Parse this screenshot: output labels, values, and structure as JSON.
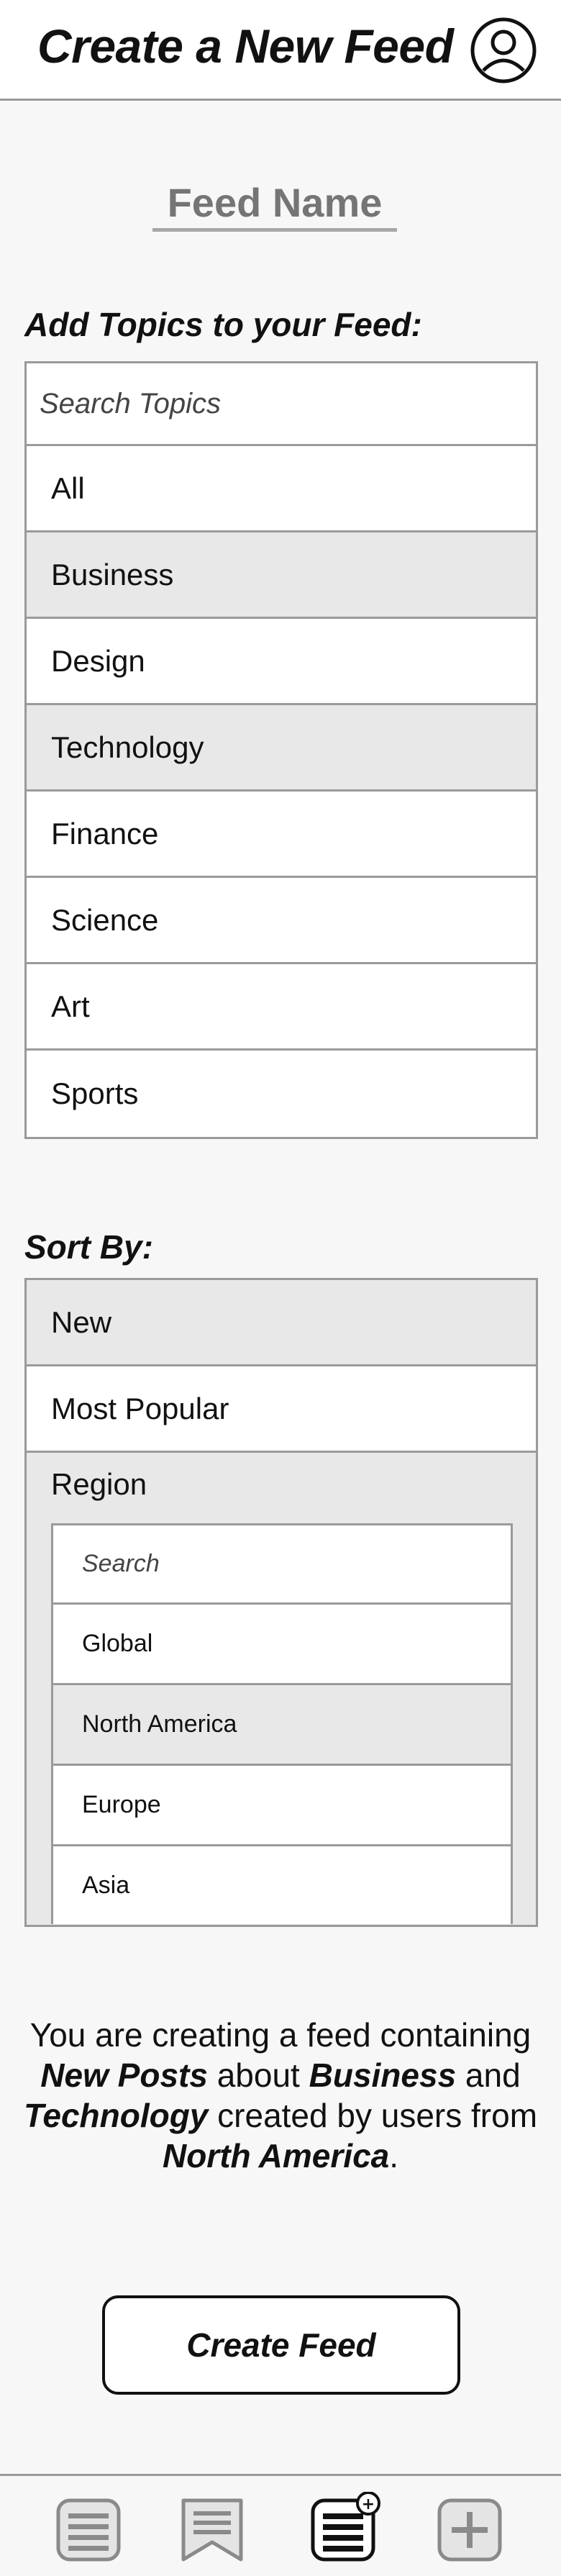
{
  "header": {
    "title": "Create a New Feed",
    "profile_icon": "user-circle-icon"
  },
  "feed_name": {
    "placeholder": "Feed Name",
    "value": ""
  },
  "topics": {
    "label": "Add Topics to your Feed:",
    "search_placeholder": "Search Topics",
    "items": [
      {
        "label": "All",
        "selected": false
      },
      {
        "label": "Business",
        "selected": true
      },
      {
        "label": "Design",
        "selected": false
      },
      {
        "label": "Technology",
        "selected": true
      },
      {
        "label": "Finance",
        "selected": false
      },
      {
        "label": "Science",
        "selected": false
      },
      {
        "label": "Art",
        "selected": false
      },
      {
        "label": "Sports",
        "selected": false
      }
    ]
  },
  "sort": {
    "label": "Sort By:",
    "items": [
      {
        "label": "New",
        "selected": true
      },
      {
        "label": "Most Popular",
        "selected": false
      }
    ],
    "region": {
      "label": "Region",
      "search_placeholder": "Search",
      "items": [
        {
          "label": "Global",
          "selected": false
        },
        {
          "label": "North America",
          "selected": true
        },
        {
          "label": "Europe",
          "selected": false
        },
        {
          "label": "Asia",
          "selected": false
        }
      ]
    }
  },
  "summary": {
    "p1": "You are creating a feed containing ",
    "b1": "New Posts",
    "p2": " about ",
    "b2": "Business",
    "p3": " and ",
    "b3": "Technology",
    "p4": " created by users from ",
    "b4": "North America",
    "p5": "."
  },
  "create_button": {
    "label": "Create Feed"
  },
  "bottom_nav": {
    "items": [
      {
        "icon": "feed-list-icon",
        "active": false
      },
      {
        "icon": "bookmark-icon",
        "active": false
      },
      {
        "icon": "new-feed-icon",
        "active": true,
        "badge": "+"
      },
      {
        "icon": "add-post-icon",
        "active": false
      }
    ]
  },
  "colors": {
    "background": "#f7f7f7",
    "border": "#9a9a9a",
    "selected": "#e8e8e8",
    "text": "#111111"
  }
}
